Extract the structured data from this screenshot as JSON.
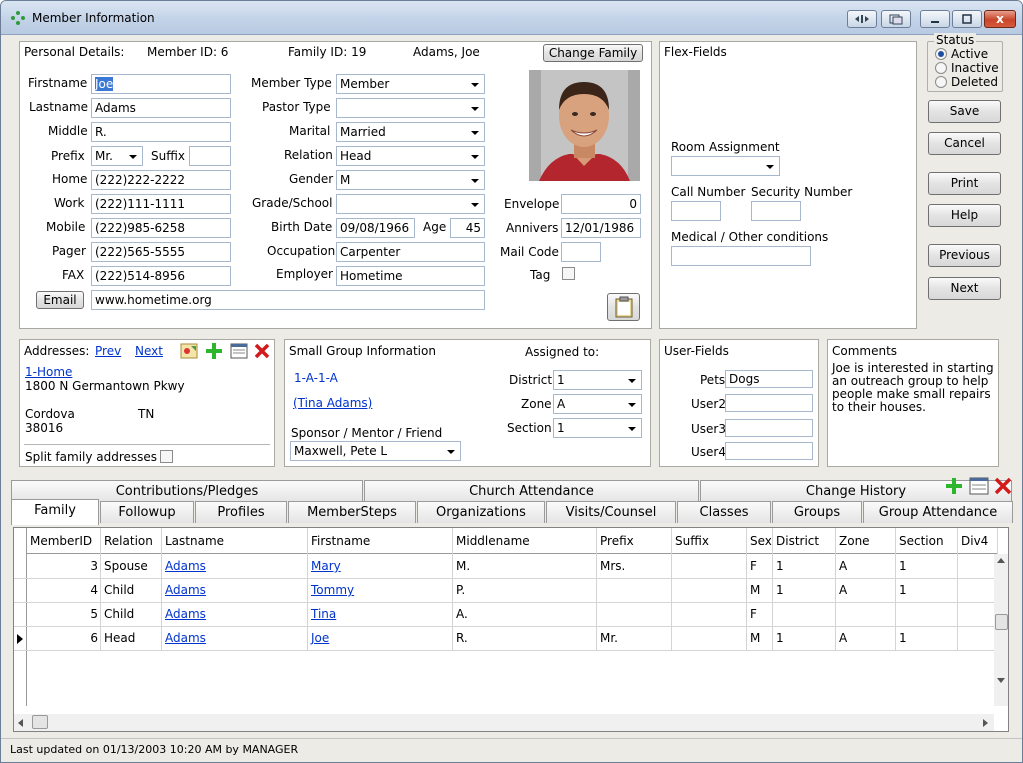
{
  "window": {
    "title": "Member Information",
    "close_glyph": "x"
  },
  "personal": {
    "header": "Personal Details:",
    "member_id": "Member ID: 6",
    "family_id": "Family ID: 19",
    "name_display": "Adams, Joe",
    "change_family": "Change Family",
    "labels": {
      "firstname": "Firstname",
      "lastname": "Lastname",
      "middle": "Middle",
      "prefix": "Prefix",
      "suffix": "Suffix",
      "home": "Home",
      "work": "Work",
      "mobile": "Mobile",
      "pager": "Pager",
      "fax": "FAX",
      "email": "Email",
      "member_type": "Member Type",
      "pastor_type": "Pastor Type",
      "marital": "Marital",
      "relation": "Relation",
      "gender": "Gender",
      "grade_school": "Grade/School",
      "birth_date": "Birth Date",
      "age": "Age",
      "occupation": "Occupation",
      "employer": "Employer",
      "envelope": "Envelope",
      "anniversary": "Annivers",
      "mail_code": "Mail Code",
      "tag": "Tag"
    },
    "values": {
      "firstname": "Joe",
      "lastname": "Adams",
      "middle": "R.",
      "prefix": "Mr.",
      "suffix": "",
      "home": "(222)222-2222",
      "work": "(222)111-1111",
      "mobile": "(222)985-6258",
      "pager": "(222)565-5555",
      "fax": "(222)514-8956",
      "email": "www.hometime.org",
      "member_type": "Member",
      "pastor_type": "",
      "marital": "Married",
      "relation": "Head",
      "gender": "M",
      "grade_school": "",
      "birth_date": "09/08/1966",
      "age": "45",
      "occupation": "Carpenter",
      "employer": "Hometime",
      "envelope": "0",
      "anniversary": "12/01/1986",
      "mail_code": ""
    }
  },
  "flex": {
    "header": "Flex-Fields",
    "room_assignment": "Room Assignment",
    "call_number": "Call Number",
    "security_number": "Security Number",
    "medical": "Medical / Other conditions"
  },
  "status": {
    "header": "Status",
    "options": [
      "Active",
      "Inactive",
      "Deleted"
    ],
    "selected": "Active"
  },
  "actions": {
    "save": "Save",
    "cancel": "Cancel",
    "print": "Print",
    "help": "Help",
    "previous": "Previous",
    "next": "Next"
  },
  "addresses": {
    "header": "Addresses:",
    "prev": "Prev",
    "next": "Next",
    "type": "1-Home",
    "street": "1800 N Germantown Pkwy",
    "city": "Cordova",
    "state": "TN",
    "zip": "38016",
    "split": "Split family addresses"
  },
  "small_group": {
    "header": "Small Group Information",
    "assigned_to": "Assigned to:",
    "code": "1-A-1-A",
    "leader": "(Tina Adams)",
    "sponsor_label": "Sponsor / Mentor / Friend",
    "sponsor_value": "Maxwell, Pete L",
    "district_label": "District",
    "district_value": "1",
    "zone_label": "Zone",
    "zone_value": "A",
    "section_label": "Section",
    "section_value": "1"
  },
  "user_fields": {
    "header": "User-Fields",
    "pets_label": "Pets",
    "pets_value": "Dogs",
    "user2": "User2",
    "user3": "User3",
    "user4": "User4"
  },
  "comments": {
    "header": "Comments",
    "text": "Joe is interested in starting an outreach group to help people make small repairs to their houses."
  },
  "tabs": {
    "row1": [
      "Contributions/Pledges",
      "Church Attendance",
      "Change History"
    ],
    "row2": [
      "Family",
      "Followup",
      "Profiles",
      "MemberSteps",
      "Organizations",
      "Visits/Counsel",
      "Classes",
      "Groups",
      "Group Attendance"
    ],
    "active": "Family"
  },
  "grid": {
    "columns": [
      "MemberID",
      "Relation",
      "Lastname",
      "Firstname",
      "Middlename",
      "Prefix",
      "Suffix",
      "Sex",
      "District",
      "Zone",
      "Section",
      "Div4"
    ],
    "rows": [
      {
        "member_id": "3",
        "relation": "Spouse",
        "lastname": "Adams",
        "firstname": "Mary",
        "middle": "M.",
        "prefix": "Mrs.",
        "suffix": "",
        "sex": "F",
        "district": "1",
        "zone": "A",
        "section": "1"
      },
      {
        "member_id": "4",
        "relation": "Child",
        "lastname": "Adams",
        "firstname": "Tommy",
        "middle": "P.",
        "prefix": "",
        "suffix": "",
        "sex": "M",
        "district": "1",
        "zone": "A",
        "section": "1"
      },
      {
        "member_id": "5",
        "relation": "Child",
        "lastname": "Adams",
        "firstname": "Tina",
        "middle": "A.",
        "prefix": "",
        "suffix": "",
        "sex": "F",
        "district": "",
        "zone": "",
        "section": ""
      },
      {
        "member_id": "6",
        "relation": "Head",
        "lastname": "Adams",
        "firstname": "Joe",
        "middle": "R.",
        "prefix": "Mr.",
        "suffix": "",
        "sex": "M",
        "district": "1",
        "zone": "A",
        "section": "1"
      }
    ],
    "current_row": 3
  },
  "statusbar": {
    "text": "Last updated on 01/13/2003 10:20 AM by MANAGER"
  }
}
